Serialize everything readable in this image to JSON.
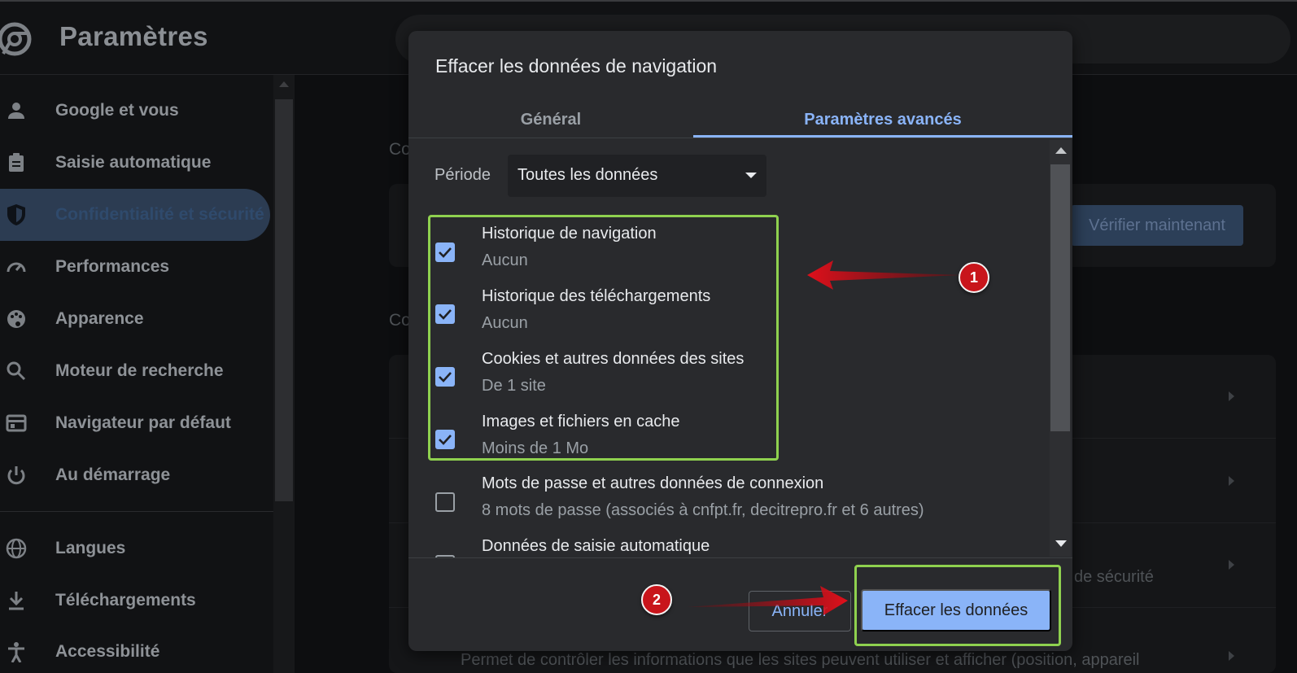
{
  "app": {
    "title": "Paramètres"
  },
  "sidebar": {
    "items": [
      {
        "label": "Google et vous",
        "icon": "person-icon"
      },
      {
        "label": "Saisie automatique",
        "icon": "clipboard-icon"
      },
      {
        "label": "Confidentialité et sécurité",
        "icon": "shield-icon",
        "active": true
      },
      {
        "label": "Performances",
        "icon": "speedometer-icon"
      },
      {
        "label": "Apparence",
        "icon": "palette-icon"
      },
      {
        "label": "Moteur de recherche",
        "icon": "search-icon"
      },
      {
        "label": "Navigateur par défaut",
        "icon": "browser-icon"
      },
      {
        "label": "Au démarrage",
        "icon": "power-icon"
      },
      {
        "label": "Langues",
        "icon": "globe-icon"
      },
      {
        "label": "Téléchargements",
        "icon": "download-icon"
      },
      {
        "label": "Accessibilité",
        "icon": "accessibility-icon"
      }
    ]
  },
  "background": {
    "section_stub_1": "Co",
    "section_stub_2": "Co",
    "verify_button": "Vérifier maintenant",
    "security_row_text": "de sécurité",
    "bottom_row_text": "Permet de contrôler les informations que les sites peuvent utiliser et afficher (position, appareil"
  },
  "dialog": {
    "title": "Effacer les données de navigation",
    "tabs": [
      {
        "label": "Général",
        "selected": false
      },
      {
        "label": "Paramètres avancés",
        "selected": true
      }
    ],
    "period_label": "Période",
    "period_value": "Toutes les données",
    "items": [
      {
        "name": "Historique de navigation",
        "desc": "Aucun",
        "checked": true
      },
      {
        "name": "Historique des téléchargements",
        "desc": "Aucun",
        "checked": true
      },
      {
        "name": "Cookies et autres données des sites",
        "desc": "De 1 site",
        "checked": true
      },
      {
        "name": "Images et fichiers en cache",
        "desc": "Moins de 1 Mo",
        "checked": true
      },
      {
        "name": "Mots de passe et autres données de connexion",
        "desc": "8 mots de passe (associés à cnfpt.fr, decitrepro.fr et 6 autres)",
        "checked": false
      },
      {
        "name": "Données de saisie automatique",
        "desc": "",
        "checked": false
      }
    ],
    "cancel_label": "Annuler",
    "confirm_label": "Effacer les données"
  },
  "annotations": {
    "badge_1": "1",
    "badge_2": "2",
    "highlight_color": "#8fd14f",
    "arrow_color": "#d0101a"
  },
  "colors": {
    "accent": "#8ab4f8",
    "dialog_bg": "#292a2d",
    "page_bg": "#111214"
  }
}
